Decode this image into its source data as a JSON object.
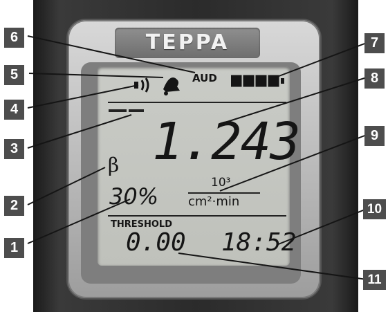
{
  "brand": "TEPPA",
  "display": {
    "audio_label": "AUD",
    "battery_level": 1.0,
    "reading": "1.243",
    "particle_symbol": "β",
    "efficiency": "30%",
    "unit_exponent": "10³",
    "unit": "cm²·min",
    "threshold_label": "THRESHOLD",
    "threshold_value": "0.00",
    "time": "18:52"
  },
  "callouts": [
    "1",
    "2",
    "3",
    "4",
    "5",
    "6",
    "7",
    "8",
    "9",
    "10",
    "11"
  ],
  "icons": [
    "speaker-icon",
    "bell-icon",
    "battery-icon"
  ],
  "colors": {
    "callout_bg": "#4d4d4d",
    "lcd_bg": "#c4c6c1",
    "segment": "#151515"
  }
}
